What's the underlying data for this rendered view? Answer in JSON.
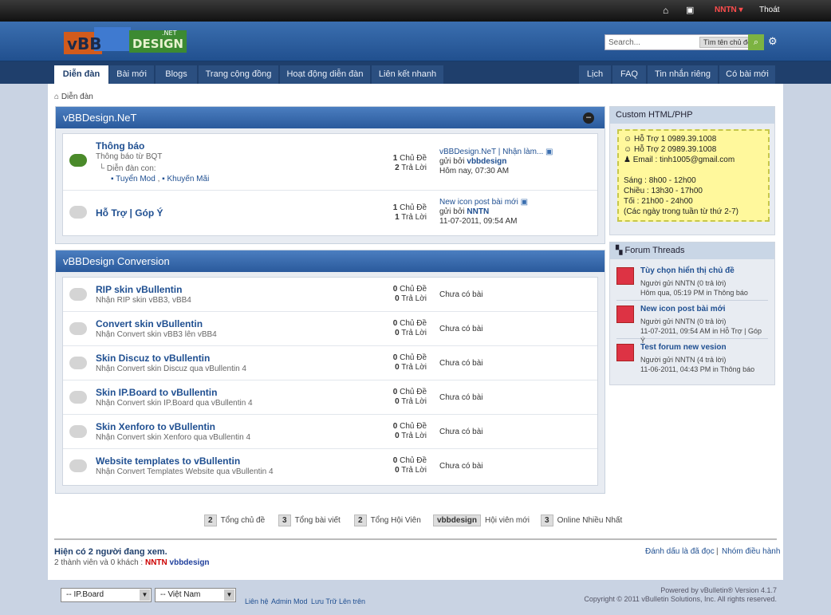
{
  "topbar": {
    "user": "NNTN",
    "logout": "Thoát"
  },
  "header": {
    "logo": "vBBDESIGN.NET",
    "search_placeholder": "Search...",
    "search_tag": "Tìm tên chủ đề"
  },
  "nav": {
    "left": [
      "Diễn đàn",
      "Bài mới",
      "Blogs",
      "Trang cộng đồng",
      "Hoạt động diễn đàn",
      "Liên kết nhanh"
    ],
    "right": [
      "Lịch",
      "FAQ",
      "Tin nhắn riêng",
      "Có bài mới"
    ]
  },
  "breadcrumb": "Diễn đàn",
  "sections": [
    {
      "title": "vBBDesign.NeT",
      "forums": [
        {
          "name": "Thông báo",
          "desc": "Thông báo từ BQT",
          "sub_label": "Diễn đàn con:",
          "subs": [
            "Tuyển Mod",
            "Khuyến Mãi"
          ],
          "topics": "1",
          "topics_label": "Chủ Đề",
          "posts": "2",
          "posts_label": "Trả Lời",
          "last_title": "vBBDesign.NeT | Nhận làm...",
          "last_by": "gửi bởi",
          "last_user": "vbbdesign",
          "last_time": "Hôm nay, 07:30 AM"
        },
        {
          "name": "Hỗ Trợ | Góp Ý",
          "topics": "1",
          "topics_label": "Chủ Đề",
          "posts": "1",
          "posts_label": "Trả Lời",
          "last_title": "New icon post bài mới",
          "last_by": "gửi bởi",
          "last_user": "NNTN",
          "last_time": "11-07-2011, 09:54 AM"
        }
      ]
    },
    {
      "title": "vBBDesign Conversion",
      "forums": [
        {
          "name": "RIP skin vBullentin",
          "desc": "Nhận RIP skin vBB3, vBB4",
          "topics": "0",
          "posts": "0",
          "last": "Chưa có bài"
        },
        {
          "name": "Convert skin vBullentin",
          "desc": "Nhận Convert skin vBB3 lên vBB4",
          "topics": "0",
          "posts": "0",
          "last": "Chưa có bài"
        },
        {
          "name": "Skin Discuz to vBullentin",
          "desc": "Nhận Convert skin Discuz qua vBullentin 4",
          "topics": "0",
          "posts": "0",
          "last": "Chưa có bài"
        },
        {
          "name": "Skin IP.Board to vBullentin",
          "desc": "Nhận Convert skin IP.Board qua vBullentin 4",
          "topics": "0",
          "posts": "0",
          "last": "Chưa có bài"
        },
        {
          "name": "Skin Xenforo to vBullentin",
          "desc": "Nhận Convert skin Xenforo qua vBullentin 4",
          "topics": "0",
          "posts": "0",
          "last": "Chưa có bài"
        },
        {
          "name": "Website templates to vBullentin",
          "desc": "Nhận Convert Templates Website qua vBullentin 4",
          "topics": "0",
          "posts": "0",
          "last": "Chưa có bài"
        }
      ]
    }
  ],
  "labels": {
    "topics": "Chủ Đề",
    "posts": "Trả Lời"
  },
  "custom": {
    "title": "Custom HTML/PHP",
    "lines": [
      "Hỗ Trợ 1 0989.39.1008",
      "Hỗ Trợ 2 0989.39.1008",
      "Email : tinh1005@gmail.com",
      "",
      "Sáng : 8h00 - 12h00",
      "Chiều : 13h30 - 17h00",
      "Tối : 21h00 - 24h00",
      "(Các ngày trong tuần từ thứ 2-7)"
    ]
  },
  "threads": {
    "title": "Forum Threads",
    "items": [
      {
        "title": "Tùy chọn hiển thị chủ đề",
        "meta1": "Người gửi NNTN (0 trả lời)",
        "meta2": "Hôm qua, 05:19 PM in Thông báo"
      },
      {
        "title": "New icon post bài mới",
        "meta1": "Người gửi NNTN (0 trả lời)",
        "meta2": "11-07-2011, 09:54 AM in Hỗ Trợ | Góp Ý"
      },
      {
        "title": "Test forum new vesion",
        "meta1": "Người gửi NNTN (4 trả lời)",
        "meta2": "11-06-2011, 04:43 PM in Thông báo"
      }
    ]
  },
  "stats": [
    {
      "num": "2",
      "label": "Tổng chủ đề"
    },
    {
      "num": "3",
      "label": "Tổng bài viết"
    },
    {
      "num": "2",
      "label": "Tổng Hội Viên"
    },
    {
      "num": "vbbdesign",
      "label": "Hội viên mới"
    },
    {
      "num": "3",
      "label": "Online Nhiều Nhất"
    }
  ],
  "online": {
    "title": "Hiện có 2 người đang xem.",
    "detail": "2 thành viên và 0 khách :",
    "user1": "NNTN",
    "user2": "vbbdesign"
  },
  "links": {
    "mark": "Đánh dấu là đã đọc",
    "sep": "|",
    "staff": "Nhóm điều hành"
  },
  "footer": {
    "style": "-- IP.Board",
    "lang": "-- Việt Nam",
    "links": [
      "Liên hệ",
      "Admin",
      "Mod",
      "Lưu Trữ",
      "Lên trên"
    ],
    "powered": "Powered by vBulletin® Version 4.1.7",
    "copyright": "Copyright © 2011 vBulletin Solutions, Inc. All rights reserved."
  }
}
